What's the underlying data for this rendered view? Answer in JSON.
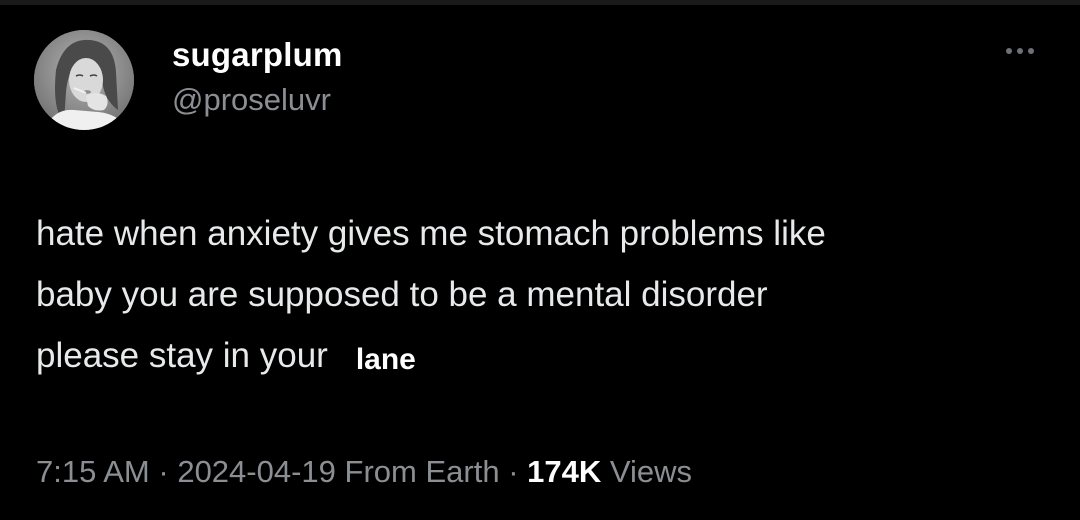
{
  "author": {
    "display_name": "sugarplum",
    "handle": "@proseluvr",
    "avatar_icon": "profile-photo"
  },
  "more_icon": "more-horizontal-icon",
  "tweet": {
    "lines": [
      "hate when anxiety gives me stomach problems like",
      "baby you are supposed to be a mental disorder",
      "please stay in your"
    ],
    "overlay_word": "lane"
  },
  "meta": {
    "time": "7:15 AM",
    "separator": "·",
    "date": "2024-04-19",
    "location": "From Earth",
    "views_count": "174K",
    "views_label": "Views"
  },
  "colors": {
    "background": "#000000",
    "primary_text": "#e7e9ea",
    "secondary_text": "#8b8f94"
  }
}
